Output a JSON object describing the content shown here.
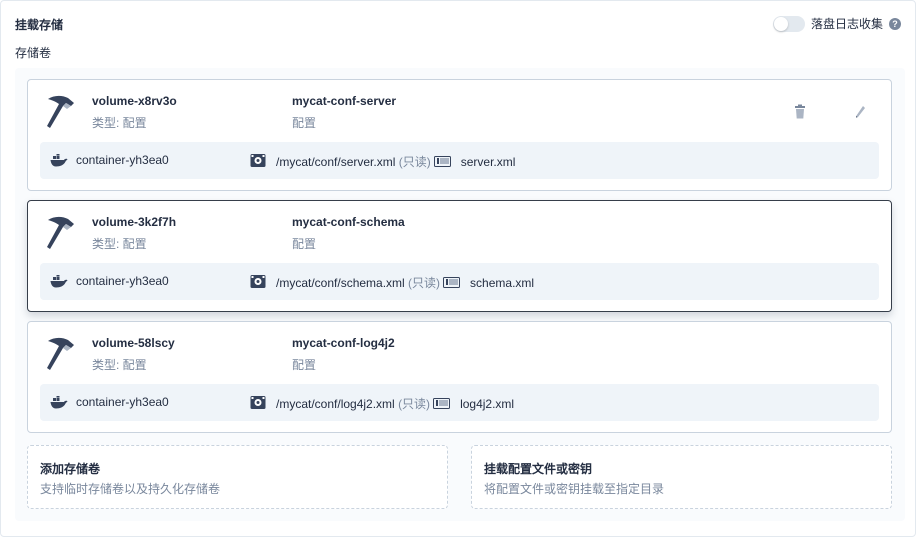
{
  "section": {
    "title": "挂载存储",
    "sub_title": "存储卷"
  },
  "log_collection": {
    "label": "落盘日志收集",
    "enabled": false,
    "help": "?"
  },
  "volumes": [
    {
      "name": "volume-x8rv3o",
      "type": "类型: 配置",
      "config_name": "mycat-conf-server",
      "config_type": "配置",
      "container": "container-yh3ea0",
      "path": "/mycat/conf/server.xml",
      "mode": "(只读)",
      "file": "server.xml"
    },
    {
      "name": "volume-3k2f7h",
      "type": "类型: 配置",
      "config_name": "mycat-conf-schema",
      "config_type": "配置",
      "container": "container-yh3ea0",
      "path": "/mycat/conf/schema.xml",
      "mode": "(只读)",
      "file": "schema.xml"
    },
    {
      "name": "volume-58lscy",
      "type": "类型: 配置",
      "config_name": "mycat-conf-log4j2",
      "config_type": "配置",
      "container": "container-yh3ea0",
      "path": "/mycat/conf/log4j2.xml",
      "mode": "(只读)",
      "file": "log4j2.xml"
    }
  ],
  "add_volume": {
    "title": "添加存储卷",
    "desc": "支持临时存储卷以及持久化存储卷"
  },
  "add_config": {
    "title": "挂载配置文件或密钥",
    "desc": "将配置文件或密钥挂载至指定目录"
  },
  "icons": [
    "hammer-icon",
    "trash-icon",
    "pencil-icon",
    "docker-icon",
    "disk-icon",
    "file-icon",
    "help-icon"
  ]
}
